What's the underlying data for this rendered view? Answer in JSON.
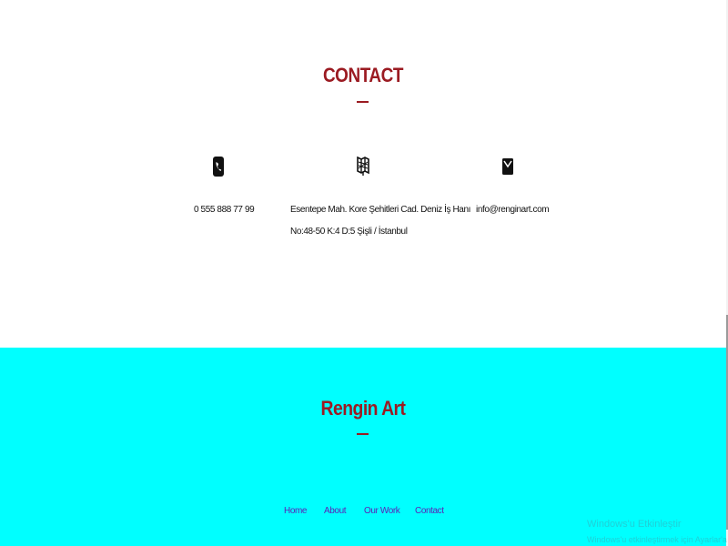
{
  "contact": {
    "title": "CONTACT",
    "phone": {
      "icon": "phone-icon",
      "text": "0 555 888 77 99"
    },
    "address": {
      "icon": "map-icon",
      "line1": "Esentepe Mah. Kore Şehitleri Cad. Deniz İş Hanı",
      "line2": "No:48-50 K:4 D:5 Şişli / İstanbul"
    },
    "email": {
      "icon": "envelope-icon",
      "text": "info@renginart.com"
    }
  },
  "footer": {
    "brand": "Rengin Art",
    "nav": [
      {
        "label": "Home"
      },
      {
        "label": "About"
      },
      {
        "label": "Our Work"
      },
      {
        "label": "Contact"
      }
    ]
  },
  "watermark": {
    "line1": "Windows'u Etkinleştir",
    "line2": "Windows'u etkinleştirmek için Ayarlar'a gidin."
  },
  "colors": {
    "accent": "#9b1b22",
    "footer_bg": "#00ffff",
    "nav_link": "#5b21b6",
    "text": "#111111"
  }
}
